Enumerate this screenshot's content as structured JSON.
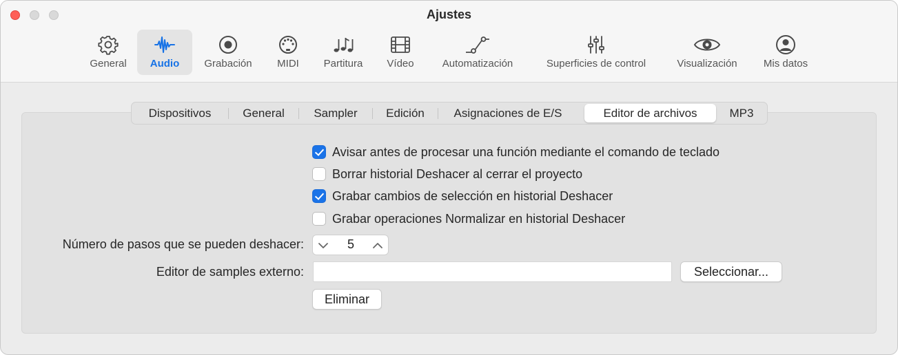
{
  "window": {
    "title": "Ajustes"
  },
  "toolbar": {
    "items": [
      {
        "label": "General",
        "icon": "gear-icon"
      },
      {
        "label": "Audio",
        "icon": "waveform-icon",
        "active": true
      },
      {
        "label": "Grabación",
        "icon": "record-icon"
      },
      {
        "label": "MIDI",
        "icon": "midi-port-icon"
      },
      {
        "label": "Partitura",
        "icon": "music-notes-icon"
      },
      {
        "label": "Vídeo",
        "icon": "film-icon"
      },
      {
        "label": "Automatización",
        "icon": "automation-curve-icon"
      },
      {
        "label": "Superficies de control",
        "icon": "sliders-icon"
      },
      {
        "label": "Visualización",
        "icon": "eye-icon"
      },
      {
        "label": "Mis datos",
        "icon": "person-icon"
      }
    ],
    "accent_color": "#1672e6"
  },
  "tabs": [
    {
      "label": "Dispositivos"
    },
    {
      "label": "General"
    },
    {
      "label": "Sampler"
    },
    {
      "label": "Edición"
    },
    {
      "label": "Asignaciones de E/S"
    },
    {
      "label": "Editor de archivos",
      "selected": true
    },
    {
      "label": "MP3"
    }
  ],
  "options": [
    {
      "label": "Avisar antes de procesar una función mediante el comando de teclado",
      "checked": true
    },
    {
      "label": "Borrar historial Deshacer al cerrar el proyecto",
      "checked": false
    },
    {
      "label": "Grabar cambios de selección en historial Deshacer",
      "checked": true
    },
    {
      "label": "Grabar operaciones Normalizar en historial Deshacer",
      "checked": false
    }
  ],
  "undo_steps": {
    "label": "Número de pasos que se pueden deshacer:",
    "value": "5"
  },
  "external_editor": {
    "label": "Editor de samples externo:",
    "value": "",
    "select_button": "Seleccionar...",
    "remove_button": "Eliminar"
  },
  "colors": {
    "checkbox_on": "#1a73e8",
    "close_button": "#fe5f57"
  }
}
